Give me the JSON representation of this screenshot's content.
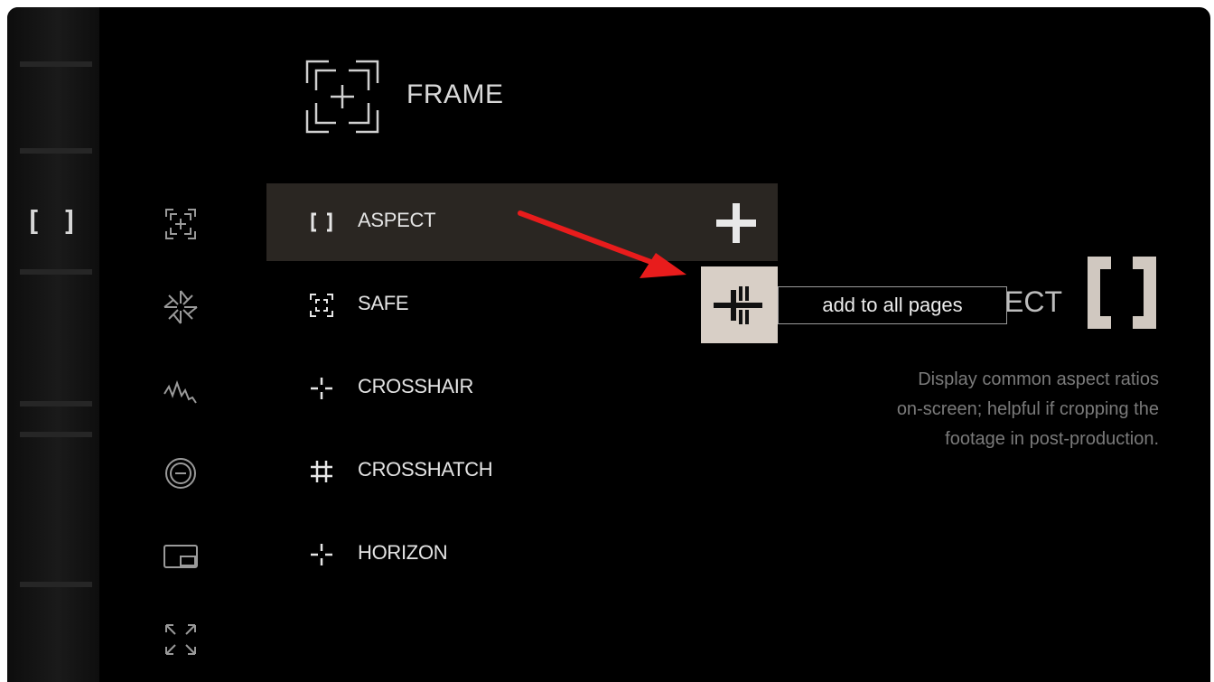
{
  "header": {
    "title": "FRAME",
    "icon": "frame-icon"
  },
  "sidebar": {
    "active_icon": "bracket-icon",
    "icons": [
      {
        "name": "frame-icon"
      },
      {
        "name": "shutter-icon"
      },
      {
        "name": "waveform-icon"
      },
      {
        "name": "exposure-icon"
      },
      {
        "name": "picture-in-picture-icon"
      },
      {
        "name": "expand-icon"
      }
    ]
  },
  "list": {
    "items": [
      {
        "label": "ASPECT",
        "icon": "bracket-icon",
        "selected": true
      },
      {
        "label": "SAFE",
        "icon": "safe-frame-icon",
        "selected": false
      },
      {
        "label": "CROSSHAIR",
        "icon": "crosshair-icon",
        "selected": false
      },
      {
        "label": "CROSSHATCH",
        "icon": "crosshatch-icon",
        "selected": false
      },
      {
        "label": "HORIZON",
        "icon": "horizon-icon",
        "selected": false
      }
    ],
    "add_icon": "plus-icon"
  },
  "popup": {
    "tooltip": "add to all pages",
    "icon": "add-to-pages-icon"
  },
  "detail": {
    "title_visible": "ECT",
    "icon": "bracket-icon",
    "description": [
      "Display common aspect ratios",
      "on-screen; helpful if cropping the",
      "footage in post-production."
    ]
  },
  "annotation": {
    "type": "arrow",
    "color": "#e81c1c"
  }
}
